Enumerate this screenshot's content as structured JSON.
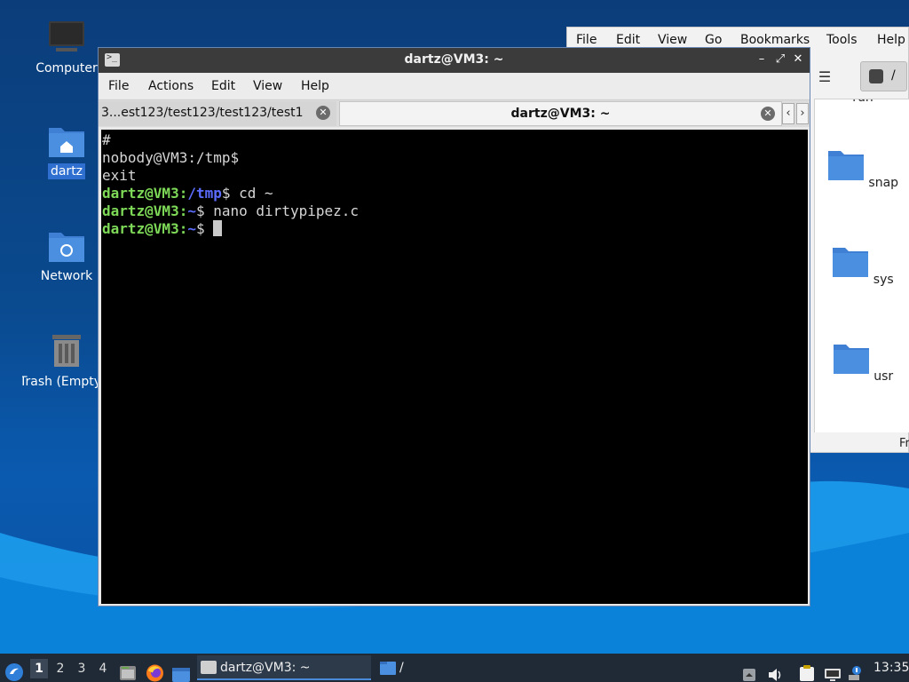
{
  "desktop": {
    "icons": [
      {
        "label": "Computer"
      },
      {
        "label": "dartz"
      },
      {
        "label": "Network"
      },
      {
        "label": "Trash (Empty)"
      }
    ]
  },
  "file_manager": {
    "menu": [
      "File",
      "Edit",
      "View",
      "Go",
      "Bookmarks",
      "Tools",
      "Help"
    ],
    "path": "/",
    "items": [
      "run",
      "snap",
      "sys",
      "usr"
    ],
    "status": "Fr"
  },
  "terminal": {
    "window_title": "dartz@VM3: ~",
    "menu": [
      "File",
      "Actions",
      "Edit",
      "View",
      "Help"
    ],
    "tabs": [
      {
        "label": "3...est123/test123/test123/test1"
      },
      {
        "label": "dartz@VM3: ~"
      }
    ],
    "lines": {
      "l1": "#",
      "l2": "nobody@VM3:/tmp$",
      "l3": "exit",
      "l4_user": "dartz@VM3",
      "l4_colon": ":",
      "l4_path": "/tmp",
      "l4_cmd": "$ cd ~",
      "l5_user": "dartz@VM3",
      "l5_colon": ":",
      "l5_path": "~",
      "l5_cmd": "$ nano dirtypipez.c",
      "l6_user": "dartz@VM3",
      "l6_colon": ":",
      "l6_path": "~",
      "l6_cmd": "$ "
    }
  },
  "taskbar": {
    "workspaces": [
      "1",
      "2",
      "3",
      "4"
    ],
    "tasks": [
      {
        "label": "dartz@VM3: ~"
      },
      {
        "label": "/"
      }
    ],
    "clock": "13:35"
  },
  "colors": {
    "prompt_user": "#7dd957",
    "prompt_path": "#5b6cff",
    "folder_blue": "#4a8fe0"
  }
}
